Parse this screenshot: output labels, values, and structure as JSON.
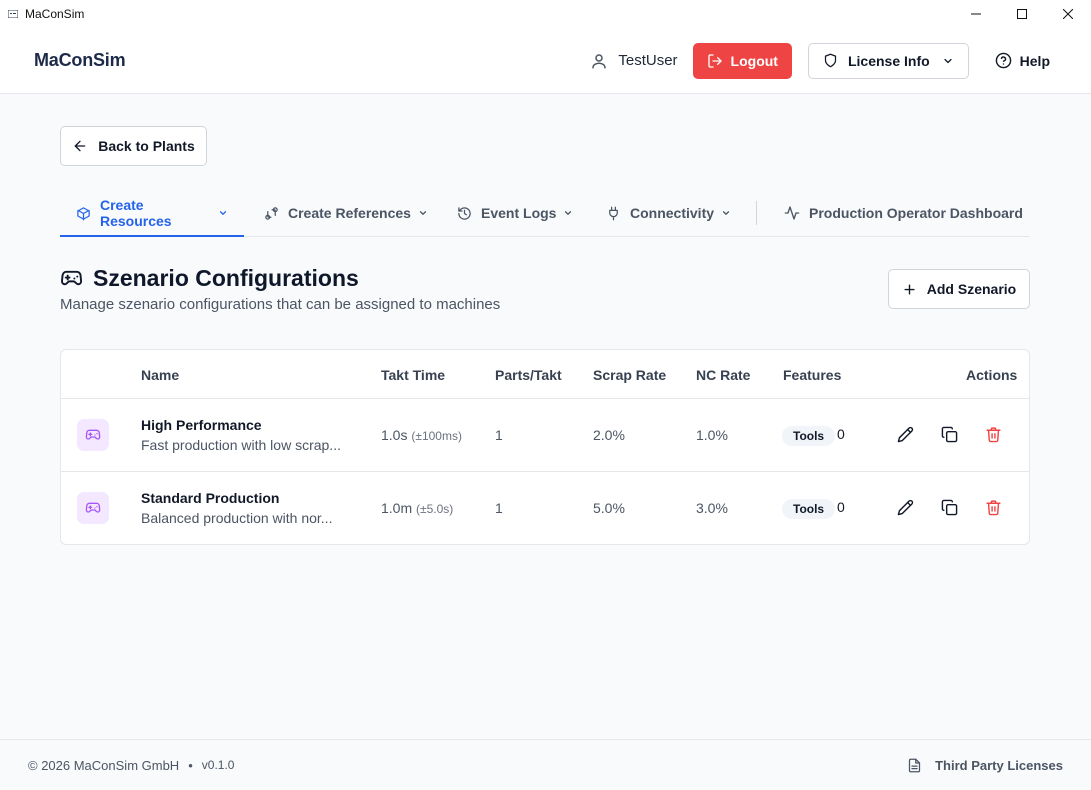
{
  "window": {
    "title": "MaConSim"
  },
  "header": {
    "brand": "MaConSim",
    "user": "TestUser",
    "logout_label": "Logout",
    "license_label": "License Info",
    "help_label": "Help"
  },
  "back_label": "Back to Plants",
  "tabs": [
    {
      "label": "Create Resources",
      "icon": "box-icon",
      "active": true
    },
    {
      "label": "Create References",
      "icon": "git-compare-icon"
    },
    {
      "label": "Event Logs",
      "icon": "history-icon"
    },
    {
      "label": "Connectivity",
      "icon": "plug-icon"
    },
    {
      "label": "Production Operator Dashboard",
      "icon": "activity-icon"
    }
  ],
  "section": {
    "title": "Szenario Configurations",
    "subtitle": "Manage szenario configurations that can be assigned to machines",
    "add_label": "Add Szenario"
  },
  "table": {
    "columns": [
      "Name",
      "Takt Time",
      "Parts/Takt",
      "Scrap Rate",
      "NC Rate",
      "Features",
      "Actions"
    ],
    "rows": [
      {
        "name": "High Performance",
        "description": "Fast production with low scrap...",
        "takt": "1.0s",
        "takt_var": "(±100ms)",
        "parts": "1",
        "scrap": "2.0%",
        "nc": "1.0%",
        "feature": "Tools",
        "count": "0"
      },
      {
        "name": "Standard Production",
        "description": "Balanced production with nor...",
        "takt": "1.0m",
        "takt_var": "(±5.0s)",
        "parts": "1",
        "scrap": "5.0%",
        "nc": "3.0%",
        "feature": "Tools",
        "count": "0"
      }
    ]
  },
  "footer": {
    "copyright": "© 2026 MaConSim GmbH",
    "separator": "•",
    "version": "v0.1.0",
    "licenses": "Third Party Licenses"
  },
  "colors": {
    "accent": "#2563eb",
    "danger": "#ef4444",
    "row_icon_bg": "#f3e8ff",
    "row_icon": "#a855f7"
  }
}
